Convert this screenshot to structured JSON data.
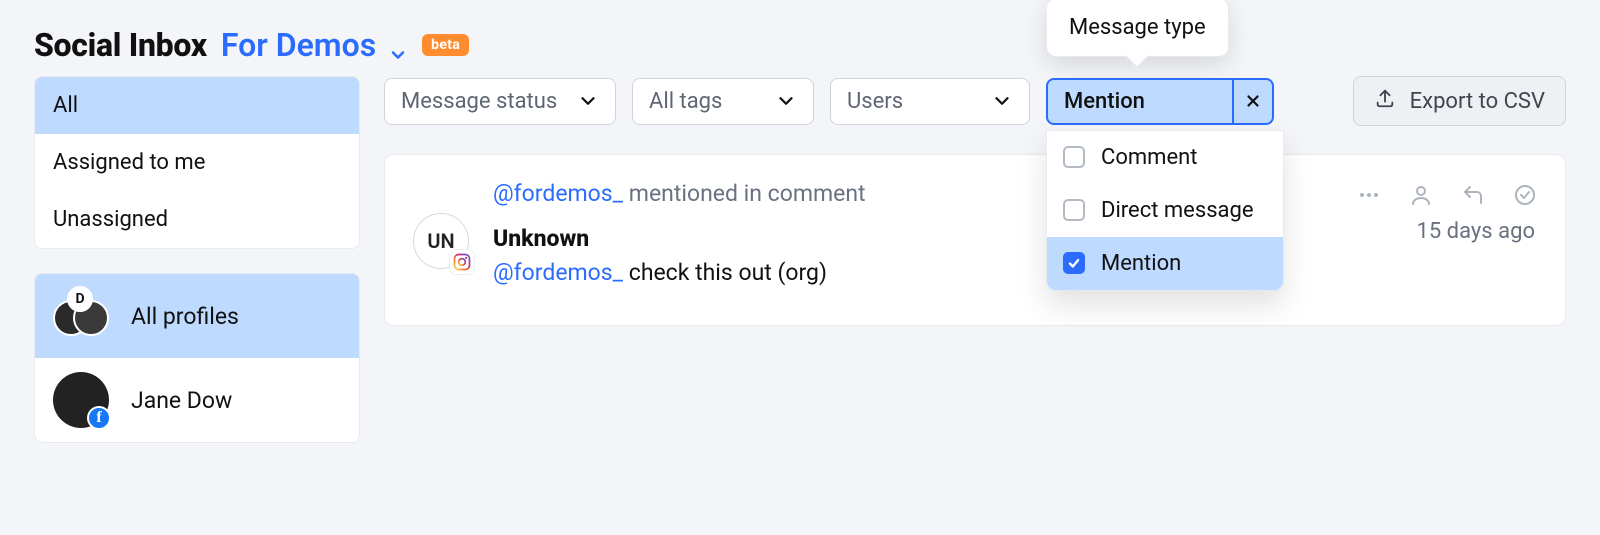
{
  "header": {
    "title": "Social Inbox",
    "workspace": "For Demos",
    "beta": "beta"
  },
  "sidebar": {
    "items": [
      {
        "label": "All"
      },
      {
        "label": "Assigned to me"
      },
      {
        "label": "Unassigned"
      }
    ],
    "profiles": [
      {
        "label": "All profiles",
        "cluster_badge": "D"
      },
      {
        "label": "Jane Dow"
      }
    ]
  },
  "filters": {
    "status": "Message status",
    "tags": "All tags",
    "users": "Users",
    "message_type": {
      "tooltip": "Message type",
      "selected": "Mention",
      "options": [
        {
          "label": "Comment",
          "checked": false
        },
        {
          "label": "Direct message",
          "checked": false
        },
        {
          "label": "Mention",
          "checked": true
        }
      ]
    },
    "export": "Export to CSV"
  },
  "message": {
    "handle": "@fordemos_",
    "context": "mentioned in comment",
    "author": "Unknown",
    "body_handle": "@fordemos_",
    "body_text": "check this out (org)",
    "time": "15 days ago",
    "avatar_initials": "UN"
  }
}
